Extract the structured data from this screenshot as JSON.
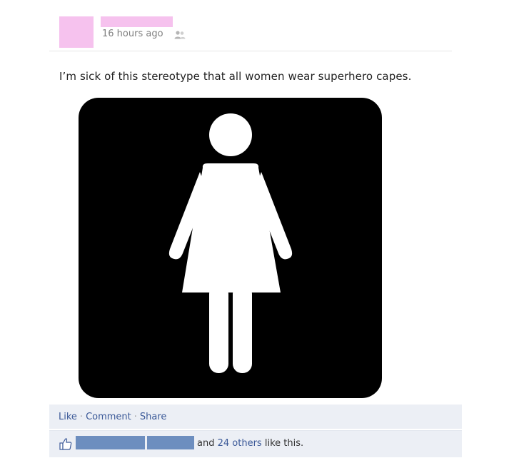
{
  "post": {
    "timestamp": "16 hours ago",
    "privacy_icon": "friends-icon",
    "status_text": "I’m sick of this stereotype that all women wear superhero capes.",
    "image_icon": "female-restroom-sign"
  },
  "actions": {
    "like_label": "Like",
    "separator": "·",
    "comment_label": "Comment",
    "share_label": "Share"
  },
  "likes": {
    "icon": "thumbs-up-icon",
    "prefix": "and",
    "others_link": "24 others",
    "suffix": "like this."
  },
  "colors": {
    "link": "#3b5998",
    "redaction_pink": "#f6c2ee",
    "redaction_blue": "#6d8ebf",
    "bar_bg": "#eceff5"
  }
}
